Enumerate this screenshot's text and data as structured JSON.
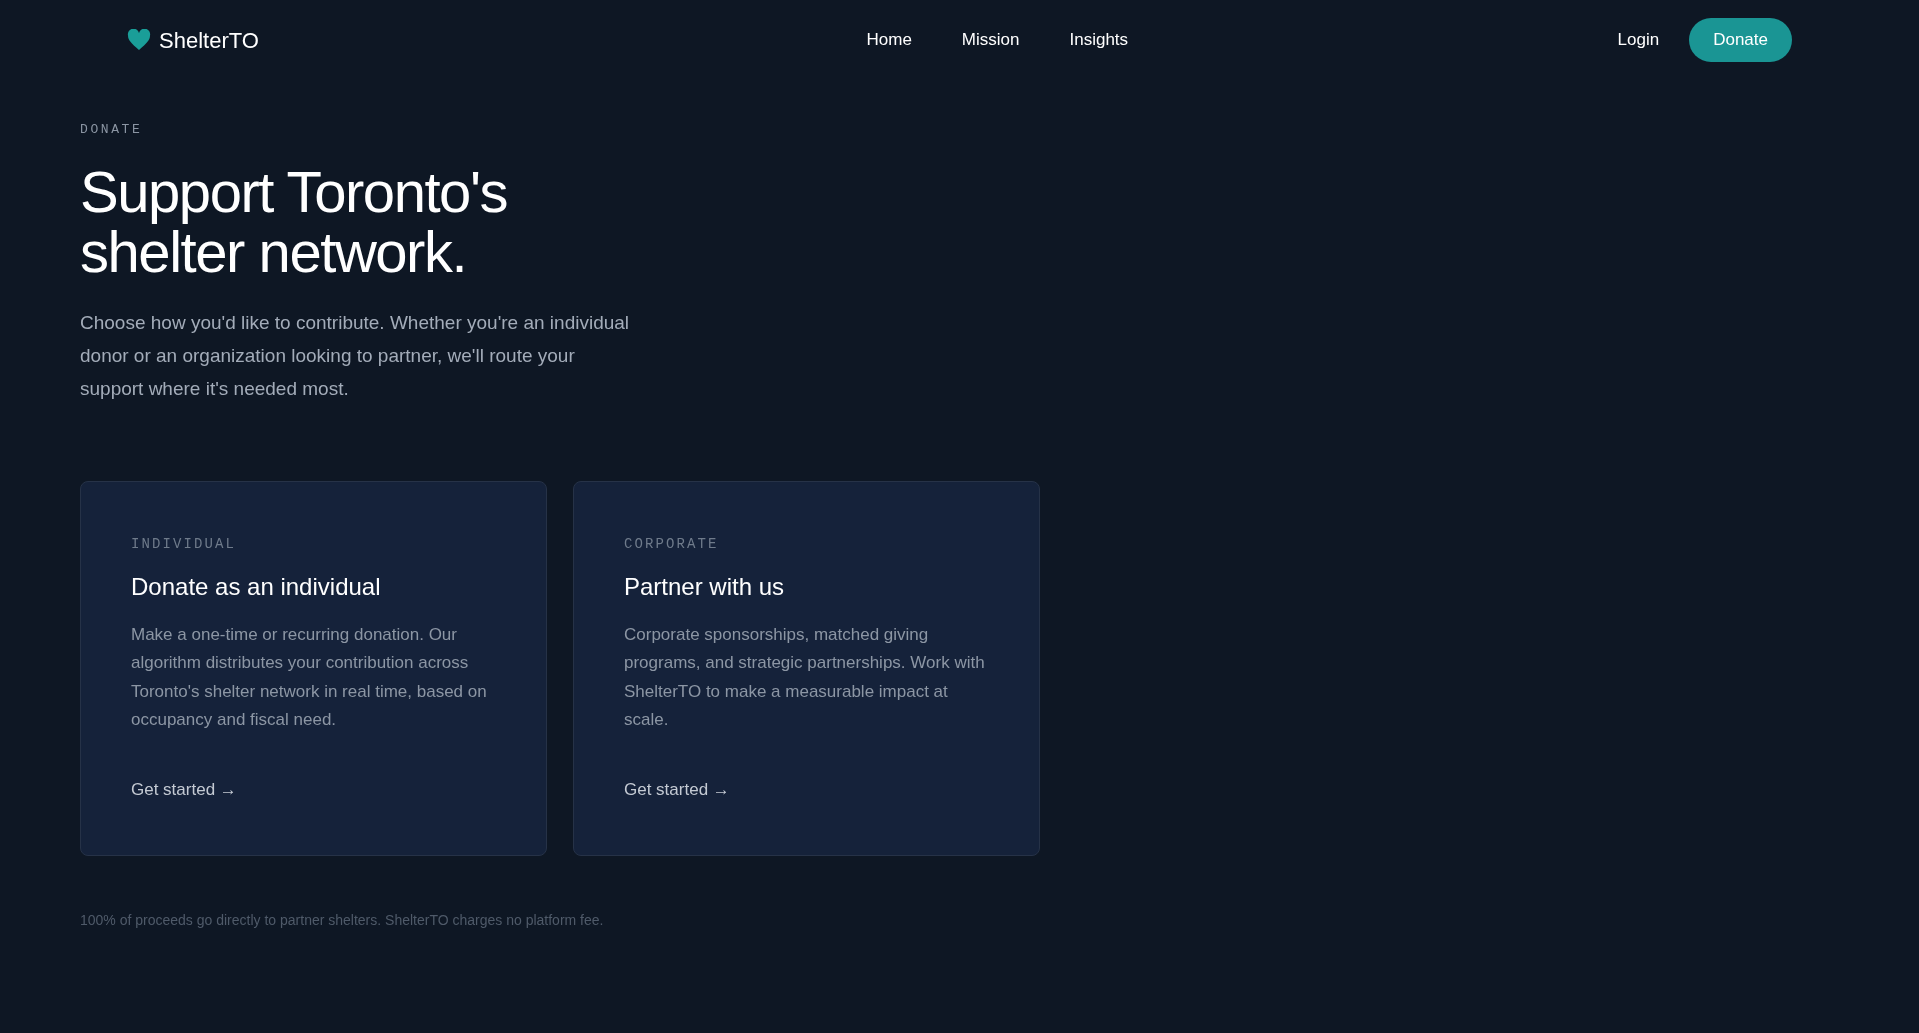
{
  "header": {
    "brand": "ShelterTO",
    "nav": [
      {
        "label": "Home"
      },
      {
        "label": "Mission"
      },
      {
        "label": "Insights"
      }
    ],
    "login": "Login",
    "donate": "Donate"
  },
  "hero": {
    "eyebrow": "DONATE",
    "title_lines": [
      "Support Toronto's",
      "shelter network."
    ],
    "intro": "Choose how you'd like to contribute. Whether you're an individual donor or an organization looking to partner, we'll route your support where it's needed most."
  },
  "cards": [
    {
      "eyebrow": "INDIVIDUAL",
      "title": "Donate as an individual",
      "body": "Make a one-time or recurring donation. Our algorithm distributes your contribution across Toronto's shelter network in real time, based on occupancy and fiscal need.",
      "link": "Get started →"
    },
    {
      "eyebrow": "CORPORATE",
      "title": "Partner with us",
      "body": "Corporate sponsorships, matched giving programs, and strategic partnerships. Work with ShelterTO to make a measurable impact at scale.",
      "link": "Get started →"
    }
  ],
  "footnote": "100% of proceeds go directly to partner shelters. ShelterTO charges no platform fee."
}
